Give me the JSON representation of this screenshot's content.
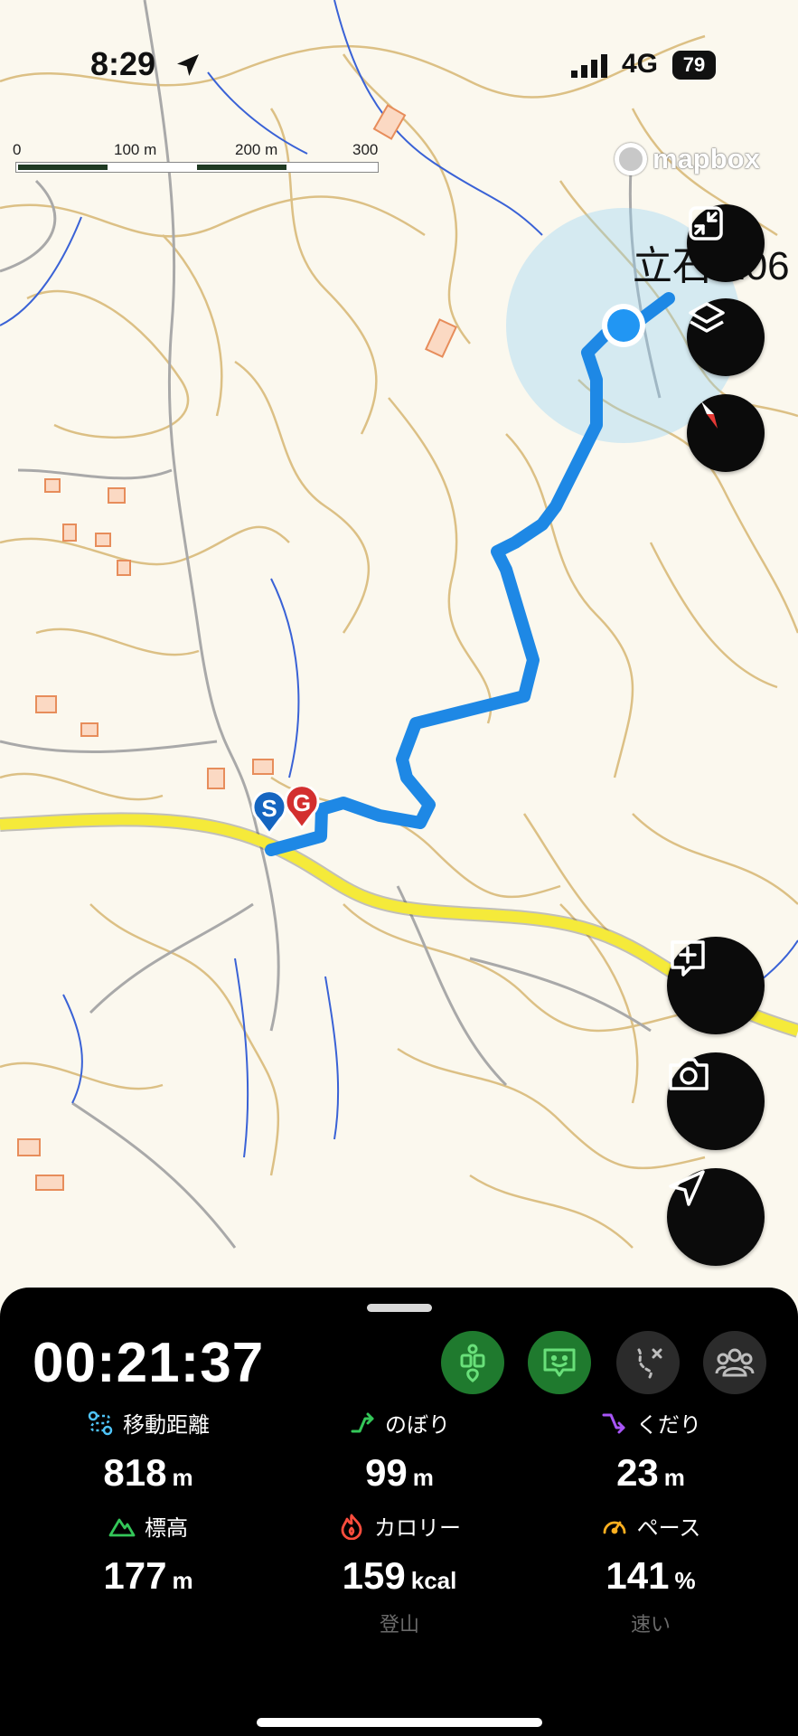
{
  "status_bar": {
    "time": "8:29",
    "network": "4G",
    "battery": "79"
  },
  "map": {
    "scale": {
      "labels": [
        "0",
        "100 m",
        "200 m",
        "300 m"
      ]
    },
    "attribution": "mapbox",
    "peak_label": "立石 206",
    "start_marker": "S",
    "goal_marker": "G",
    "colors": {
      "track": "#1e88e5",
      "road": "#f5ea3a",
      "contour": "#d8b978",
      "position": "#2196f3"
    },
    "buttons": [
      "collapse-icon",
      "layers-icon",
      "compass-icon",
      "add-comment-icon",
      "camera-icon",
      "navigation-icon"
    ]
  },
  "panel": {
    "elapsed": "00:21:37",
    "mode_buttons": [
      {
        "icon": "hiker-icon",
        "active": true
      },
      {
        "icon": "chat-face-icon",
        "active": true
      },
      {
        "icon": "route-plan-icon",
        "active": false
      },
      {
        "icon": "group-icon",
        "active": false
      }
    ],
    "stats": [
      {
        "label": "移動距離",
        "value": "818",
        "unit": "m",
        "sub": "",
        "icon": "distance-icon",
        "color": "#4fc3f7"
      },
      {
        "label": "のぼり",
        "value": "99",
        "unit": "m",
        "sub": "",
        "icon": "ascent-icon",
        "color": "#34c759"
      },
      {
        "label": "くだり",
        "value": "23",
        "unit": "m",
        "sub": "",
        "icon": "descent-icon",
        "color": "#a855f7"
      },
      {
        "label": "標高",
        "value": "177",
        "unit": "m",
        "sub": "",
        "icon": "mountain-icon",
        "color": "#34c759"
      },
      {
        "label": "カロリー",
        "value": "159",
        "unit": "kcal",
        "sub": "登山",
        "icon": "flame-icon",
        "color": "#ff4d3d"
      },
      {
        "label": "ペース",
        "value": "141",
        "unit": "%",
        "sub": "速い",
        "icon": "speedometer-icon",
        "color": "#ffb020"
      }
    ]
  }
}
